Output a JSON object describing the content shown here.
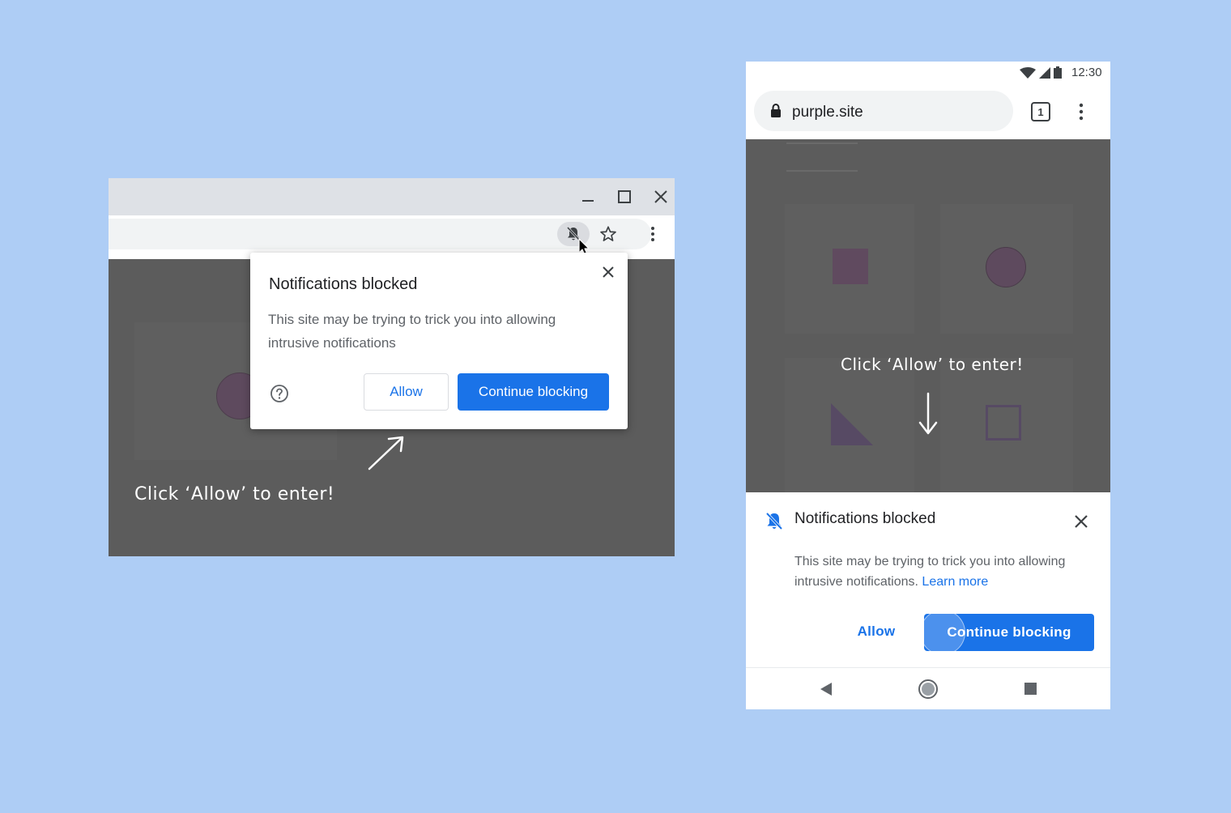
{
  "desktop": {
    "window_controls": {
      "minimize_icon": "minimize-icon",
      "maximize_icon": "maximize-icon",
      "close_icon": "close-icon"
    },
    "toolbar": {
      "notifications_icon": "bell-off-icon",
      "bookmark_icon": "star-icon",
      "menu_icon": "kebab-menu-icon"
    },
    "popup": {
      "title": "Notifications blocked",
      "body": "This site may be trying to trick you into allowing intrusive notifications",
      "help_icon": "help-circle-icon",
      "allow_label": "Allow",
      "continue_label": "Continue blocking"
    },
    "page_text": "Click ‘Allow’ to enter!"
  },
  "mobile": {
    "status_bar": {
      "time": "12:30"
    },
    "toolbar": {
      "url": "purple.site",
      "tab_count": "1"
    },
    "page_text": "Click ‘Allow’ to enter!",
    "sheet": {
      "title": "Notifications blocked",
      "body": "This site may be trying to trick you into allowing intrusive notifications.",
      "learn_more": "Learn more",
      "allow_label": "Allow",
      "continue_label": "Continue blocking"
    },
    "nav": {
      "back_icon": "back-triangle-icon",
      "home_icon": "home-circle-icon",
      "recents_icon": "recents-square-icon"
    }
  },
  "colors": {
    "background": "#aecdf5",
    "accent": "#1a73e8",
    "page_dim": "#5c5c5c"
  }
}
